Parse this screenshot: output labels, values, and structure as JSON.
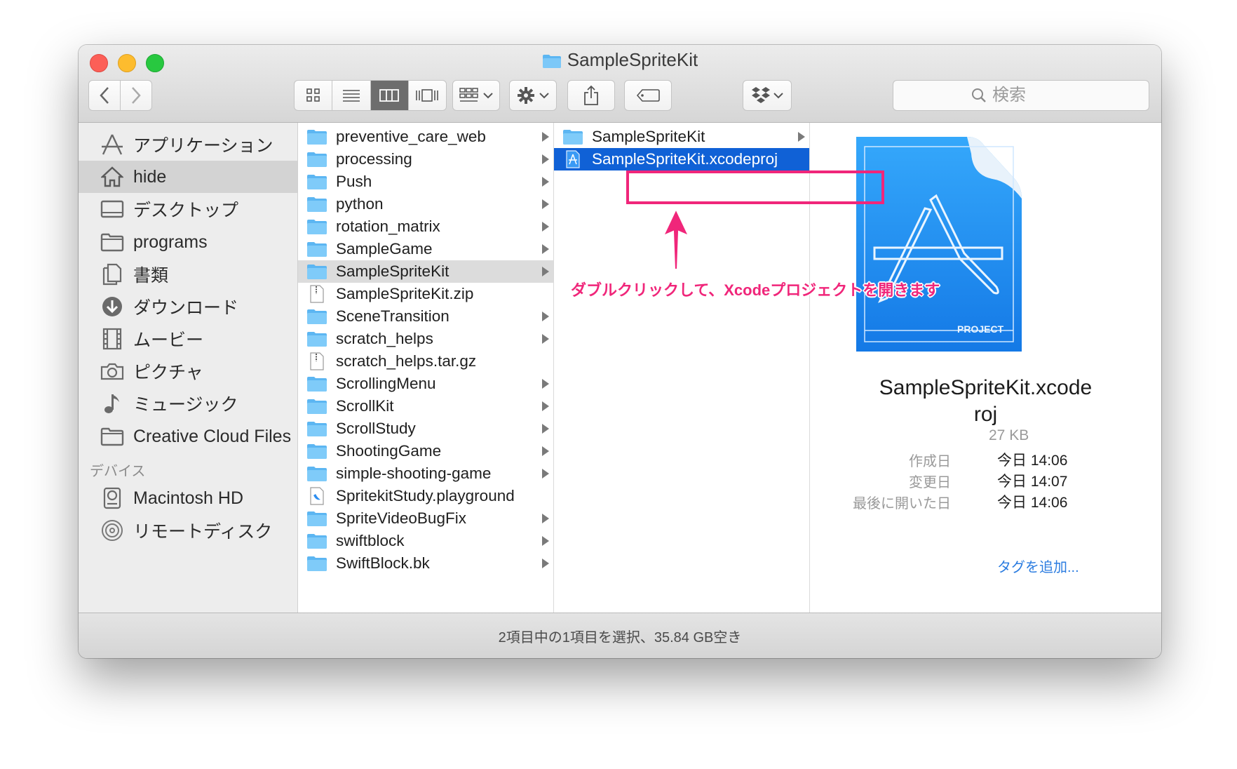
{
  "window": {
    "title": "SampleSpriteKit",
    "status": "2項目中の1項目を選択、35.84 GB空き"
  },
  "toolbar": {
    "search_placeholder": "検索",
    "view_modes": [
      "icon-view",
      "list-view",
      "column-view",
      "coverflow-view"
    ],
    "active_view": "column-view"
  },
  "sidebar": {
    "favorites": [
      {
        "label": "アプリケーション",
        "icon": "applications-icon"
      },
      {
        "label": "hide",
        "icon": "home-icon",
        "selected": true
      },
      {
        "label": "デスクトップ",
        "icon": "desktop-icon"
      },
      {
        "label": "programs",
        "icon": "folder-icon"
      },
      {
        "label": "書類",
        "icon": "documents-icon"
      },
      {
        "label": "ダウンロード",
        "icon": "download-icon"
      },
      {
        "label": "ムービー",
        "icon": "movies-icon"
      },
      {
        "label": "ピクチャ",
        "icon": "camera-icon"
      },
      {
        "label": "ミュージック",
        "icon": "music-icon"
      },
      {
        "label": "Creative Cloud Files",
        "icon": "folder-icon"
      }
    ],
    "devices_header": "デバイス",
    "devices": [
      {
        "label": "Macintosh HD",
        "icon": "hard-drive-icon"
      },
      {
        "label": "リモートディスク",
        "icon": "remote-disc-icon"
      }
    ]
  },
  "column1": {
    "items": [
      {
        "name": "preventive_care_web",
        "type": "folder"
      },
      {
        "name": "processing",
        "type": "folder"
      },
      {
        "name": "Push",
        "type": "folder"
      },
      {
        "name": "python",
        "type": "folder"
      },
      {
        "name": "rotation_matrix",
        "type": "folder"
      },
      {
        "name": "SampleGame",
        "type": "folder"
      },
      {
        "name": "SampleSpriteKit",
        "type": "folder",
        "highlighted": true
      },
      {
        "name": "SampleSpriteKit.zip",
        "type": "file"
      },
      {
        "name": "SceneTransition",
        "type": "folder"
      },
      {
        "name": "scratch_helps",
        "type": "folder"
      },
      {
        "name": "scratch_helps.tar.gz",
        "type": "file"
      },
      {
        "name": "ScrollingMenu",
        "type": "folder"
      },
      {
        "name": "ScrollKit",
        "type": "folder"
      },
      {
        "name": "ScrollStudy",
        "type": "folder"
      },
      {
        "name": "ShootingGame",
        "type": "folder"
      },
      {
        "name": "simple-shooting-game",
        "type": "folder"
      },
      {
        "name": "SpritekitStudy.playground",
        "type": "playground"
      },
      {
        "name": "SpriteVideoBugFix",
        "type": "folder"
      },
      {
        "name": "swiftblock",
        "type": "folder"
      },
      {
        "name": "SwiftBlock.bk",
        "type": "folder"
      }
    ]
  },
  "column2": {
    "items": [
      {
        "name": "SampleSpriteKit",
        "type": "folder"
      },
      {
        "name": "SampleSpriteKit.xcodeproj",
        "type": "xcodeproj",
        "selected": true
      }
    ]
  },
  "annotation": {
    "text": "ダブルクリックして、Xcodeプロジェクトを開きます",
    "color": "#f0267a"
  },
  "preview": {
    "icon_label": "PROJECT",
    "name_line1": "SampleSpriteKit.xcode",
    "name_line2": "roj",
    "size": "27 KB",
    "created_label": "作成日",
    "created_value": "今日 14:06",
    "modified_label": "変更日",
    "modified_value": "今日 14:07",
    "opened_label": "最後に開いた日",
    "opened_value": "今日 14:06",
    "add_tags": "タグを追加..."
  }
}
